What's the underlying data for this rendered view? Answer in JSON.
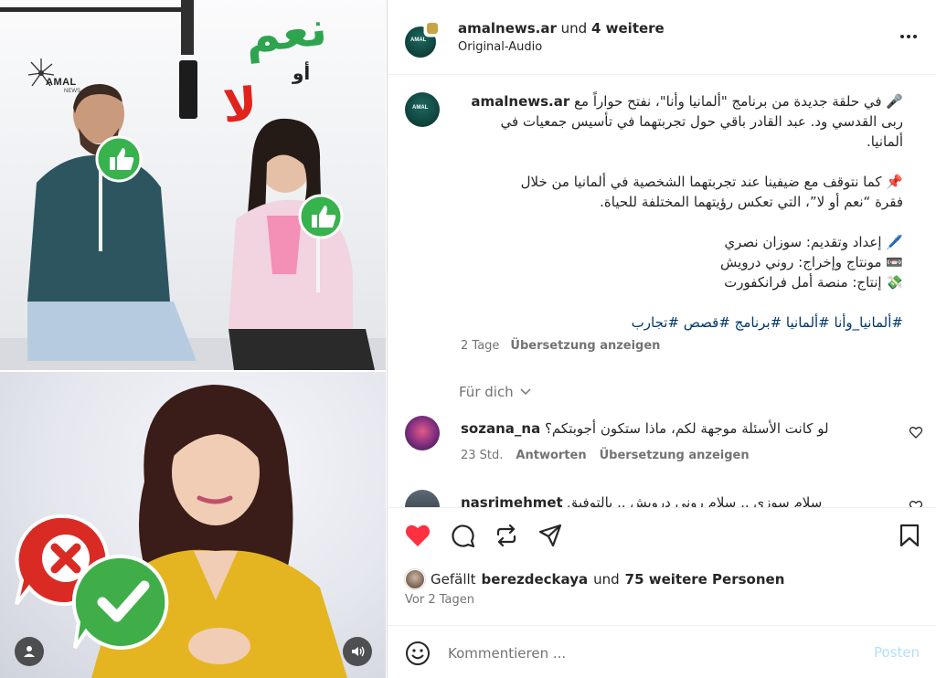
{
  "media": {
    "logo_text": "AMAL",
    "logo_sub": "NEWS",
    "title_yes": "نعم",
    "title_or": "أو",
    "title_no": "لا"
  },
  "header": {
    "username": "amalnews.ar",
    "collab_text": "und",
    "collab_more": "4 weitere",
    "audio": "Original-Audio"
  },
  "caption": {
    "username": "amalnews.ar",
    "line1": "🎤 في حلقة جديدة من برنامج \"ألمانيا وأنا\"، نفتح حواراً مع",
    "line2": "ربى القدسي ود. عبد القادر باقي حول تجربتهما في تأسيس جمعيات في",
    "line3": "ألمانيا.",
    "line4": "📌 كما نتوقف مع ضيفينا عند تجربتهما الشخصية في ألمانيا من خلال",
    "line5": "فقرة “نعم أو لا”، التي تعكس رؤيتهما المختلفة للحياة.",
    "line6": "🖊️ إعداد وتقديم: سوزان نصري",
    "line7": "📼 مونتاج وإخراج: روني درويش",
    "line8": "💸 إنتاج: منصة أمل فرانكفورت",
    "hashtags": "#ألمانيا_وأنا #ألمانيا #برنامج #قصص #تجارب",
    "age": "2 Tage",
    "translate": "Übersetzung anzeigen"
  },
  "for_you": "Für dich",
  "comments": [
    {
      "username": "sozana_na",
      "text": "لو كانت الأسئلة موجهة لكم، ماذا ستكون أجوبتكم؟",
      "age": "23 Std.",
      "reply": "Antworten",
      "translate": "Übersetzung anzeigen"
    },
    {
      "username": "nasrimehmet",
      "text": "سلام سوزي .. سلام روني درويش .. بالتوفيق"
    }
  ],
  "actions": {
    "liked": true,
    "like_color": "#ff3040"
  },
  "likes": {
    "prefix": "Gefällt",
    "user": "berezdeckaya",
    "mid": "und",
    "count": "75 weitere Personen"
  },
  "post_date": "Vor 2 Tagen",
  "comment_box": {
    "placeholder": "Kommentieren ...",
    "post_label": "Posten"
  }
}
